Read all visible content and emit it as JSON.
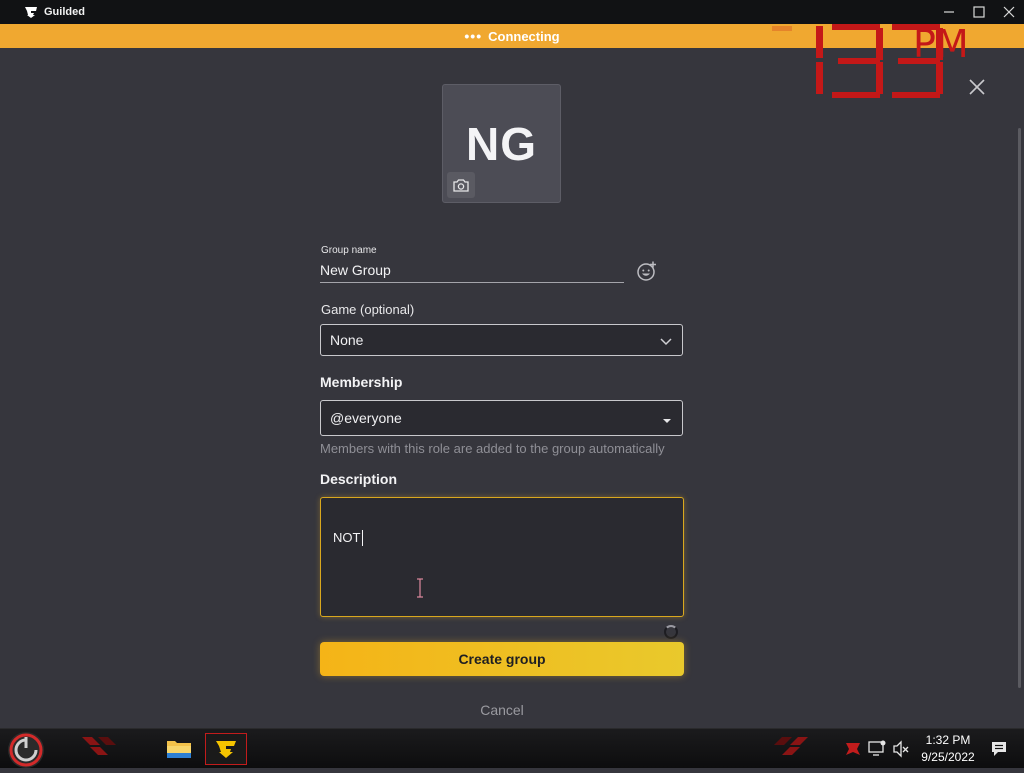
{
  "titlebar": {
    "app_name": "Guilded",
    "minimize_symbol": "—",
    "maximize_symbol": "☐",
    "close_symbol": "✕"
  },
  "banner": {
    "dots": "•••",
    "text": "Connecting",
    "color": "#f0a830"
  },
  "overlay_clock": {
    "digits": "133",
    "suffix": "PM",
    "color": "#c41818"
  },
  "dialog": {
    "close_symbol": "✕",
    "avatar_initials": "NG",
    "group_name_label": "Group name",
    "group_name_value": "New Group",
    "game_label": "Game (optional)",
    "game_value": "None",
    "membership_label": "Membership",
    "membership_value": "@everyone",
    "membership_helper": "Members with this role are added to the group automatically",
    "description_label": "Description",
    "description_value": "NOT",
    "create_button": "Create group",
    "cancel_button": "Cancel",
    "accent_color": "#f5b417"
  },
  "taskbar": {
    "apps": [
      "file-explorer",
      "guilded"
    ],
    "time": "1:32 PM",
    "date": "9/25/2022",
    "accent_color": "#c21c1c"
  }
}
